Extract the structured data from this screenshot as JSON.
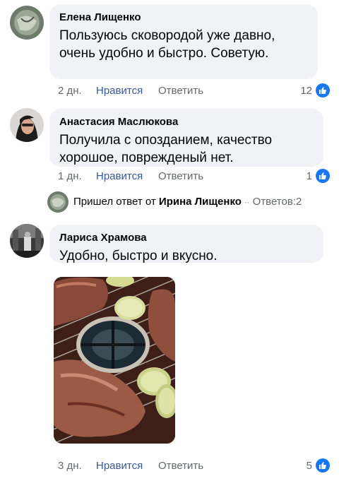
{
  "comments": [
    {
      "author": "Елена Лищенко",
      "text": "Пользуюсь сковородой уже давно, очень удобно и быстро. Советую.",
      "time": "2 дн.",
      "like_label": "Нравится",
      "reply_label": "Ответить",
      "likes": "12"
    },
    {
      "author": "Анастасия Маслюкова",
      "text": "Получила с опозданием, качество хорошое, поврежденый нет.",
      "time": "1 дн.",
      "like_label": "Нравится",
      "reply_label": "Ответить",
      "likes": "1"
    },
    {
      "author": "Лариса Храмова",
      "text": "Удобно, быстро и вкусно.",
      "time": "3 дн.",
      "like_label": "Нравится",
      "reply_label": "Ответить",
      "likes": "5"
    }
  ],
  "reply_notice": {
    "prefix": "Пришел ответ от",
    "author": "Ирина Лищенко",
    "separator": "··",
    "replies": "Ответов:2"
  },
  "colors": {
    "bubble": "#f0f2f5",
    "like_blue": "#1877f2",
    "link_blue": "#385898",
    "muted": "#65676b"
  }
}
